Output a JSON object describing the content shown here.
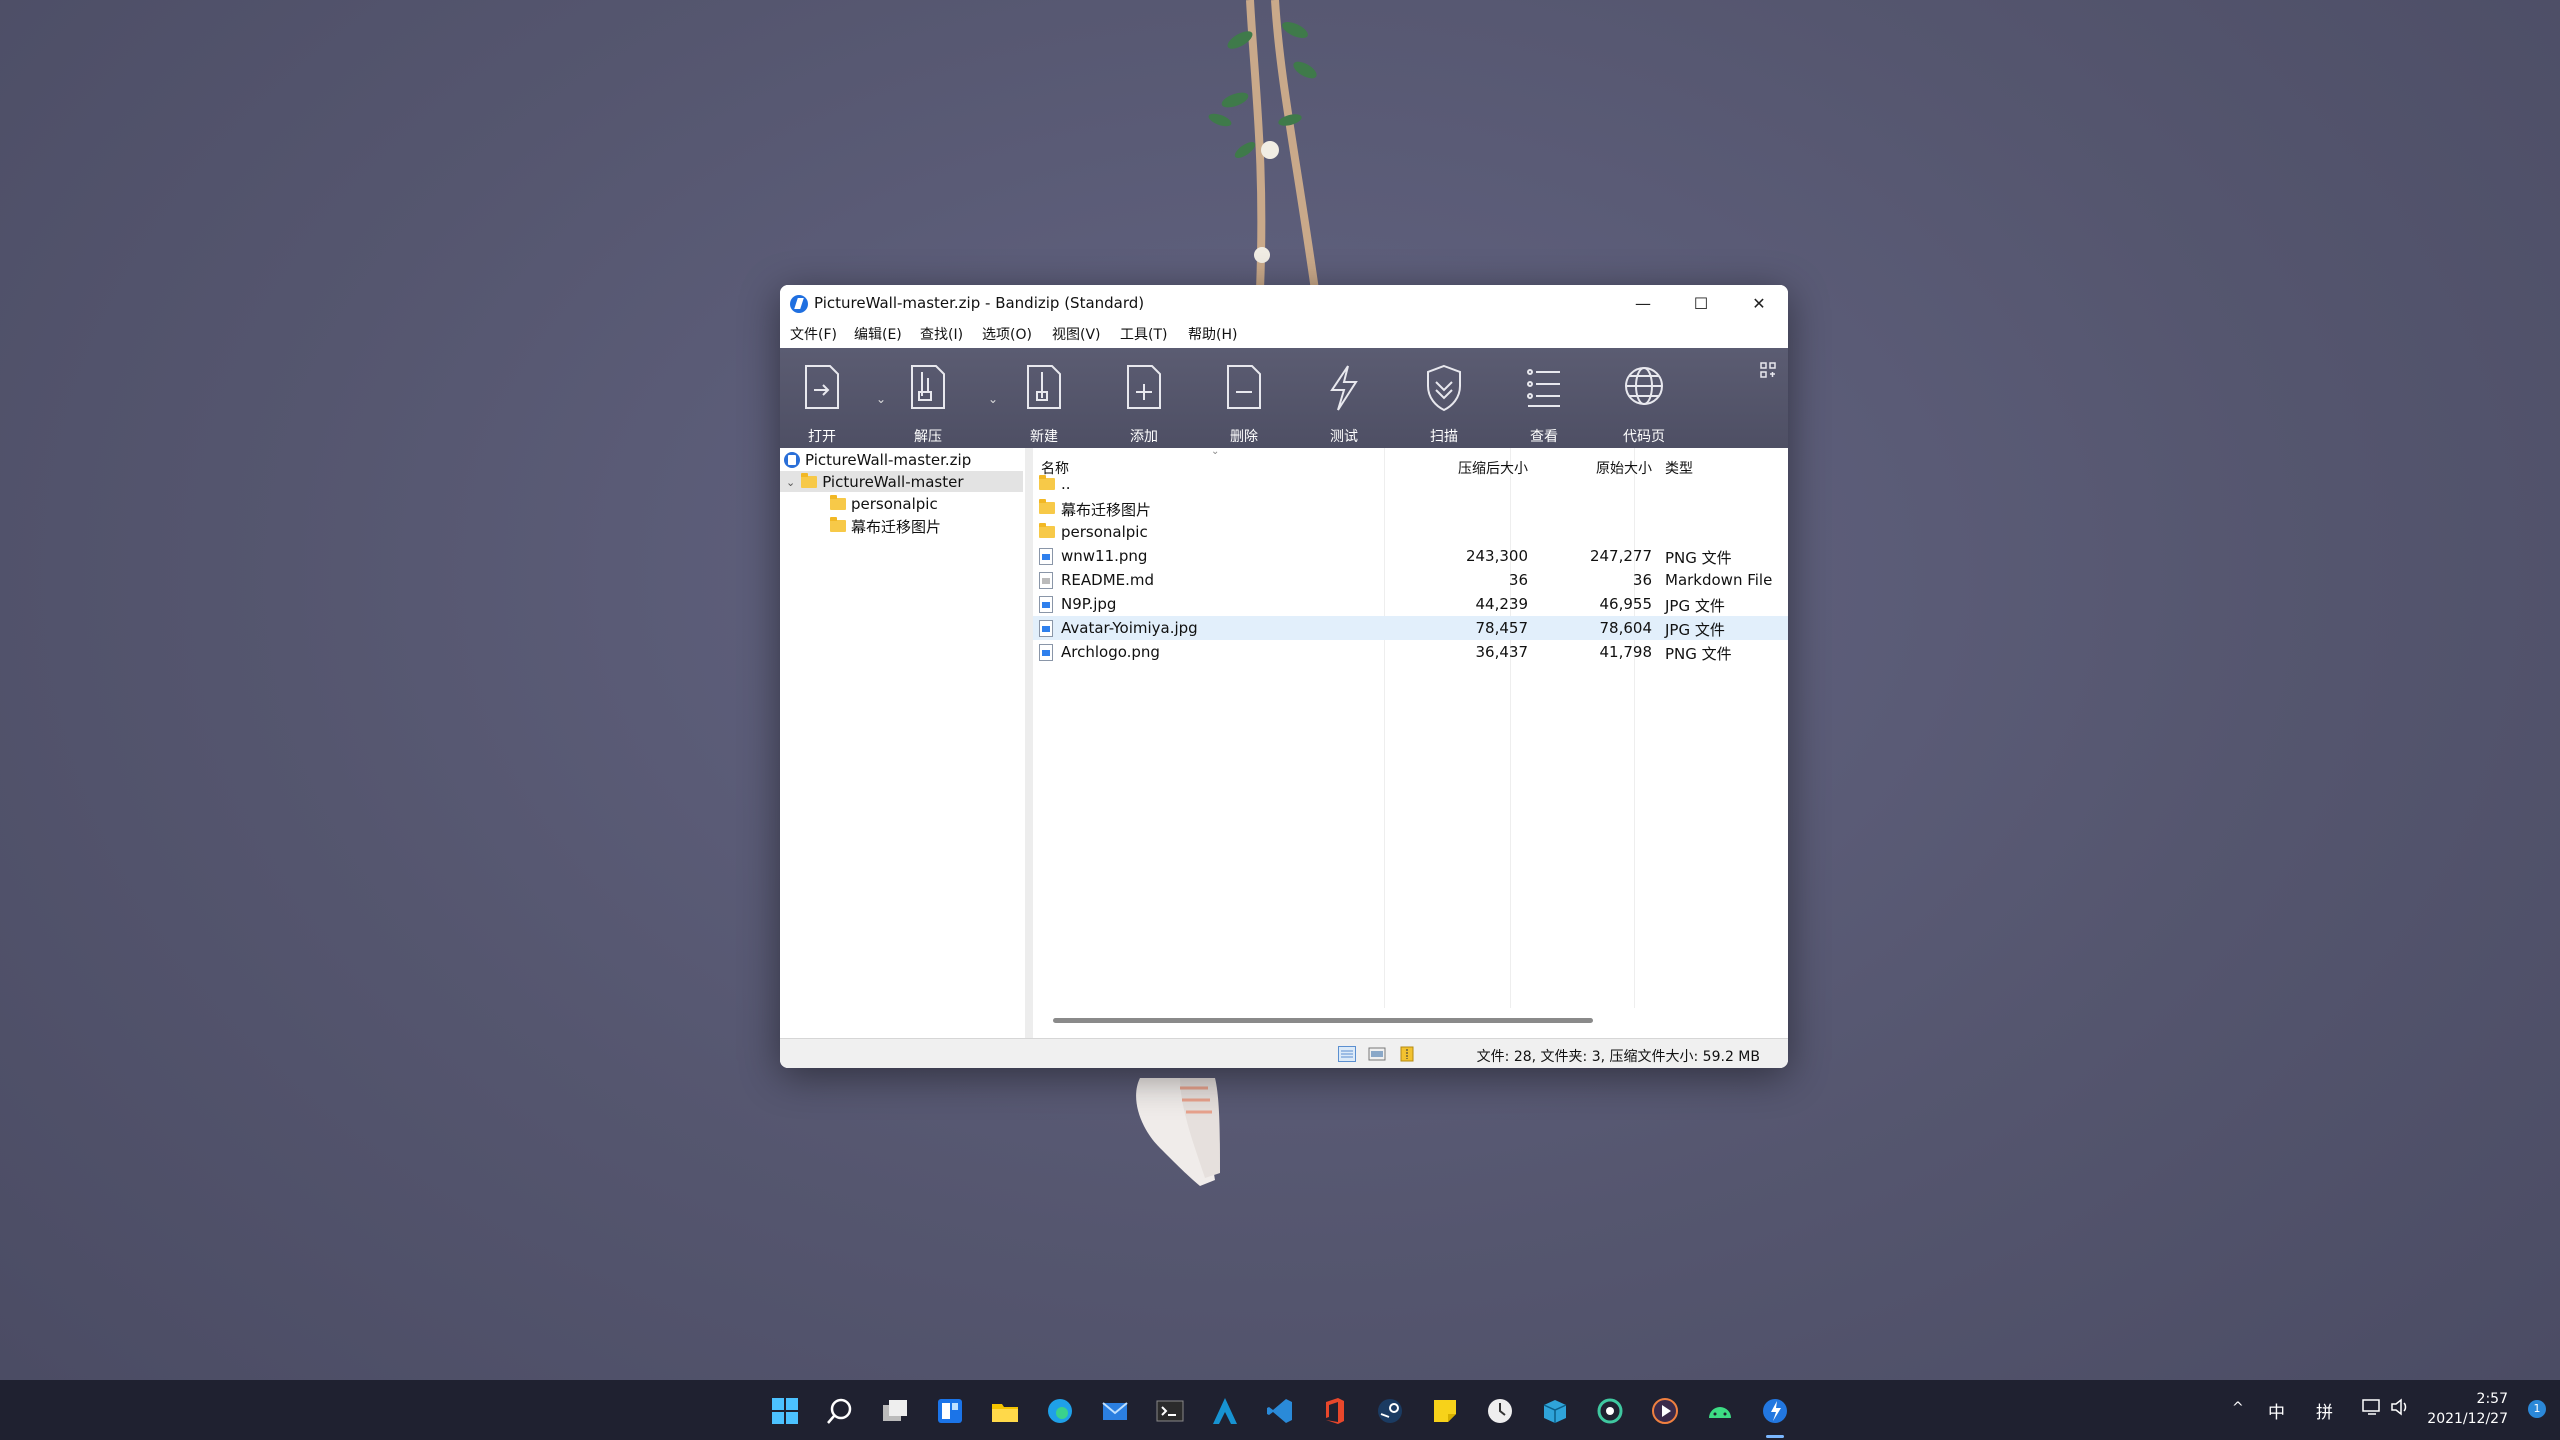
{
  "window": {
    "title": "PictureWall-master.zip - Bandizip (Standard)",
    "controls": {
      "minimize": "—",
      "maximize": "☐",
      "close": "✕"
    }
  },
  "menu": [
    "文件(F)",
    "编辑(E)",
    "查找(I)",
    "选项(O)",
    "视图(V)",
    "工具(T)",
    "帮助(H)"
  ],
  "toolbar": {
    "open": "打开",
    "extract": "解压",
    "new": "新建",
    "add": "添加",
    "delete": "删除",
    "test": "测试",
    "scan": "扫描",
    "view": "查看",
    "codepage": "代码页"
  },
  "tree": {
    "root": "PictureWall-master.zip",
    "folder": "PictureWall-master",
    "children": [
      "personalpic",
      "幕布迁移图片"
    ]
  },
  "columns": {
    "name": "名称",
    "compressed": "压缩后大小",
    "original": "原始大小",
    "type": "类型"
  },
  "files": [
    {
      "name": "..",
      "icon": "folder-icon",
      "compressed": "",
      "original": "",
      "type": ""
    },
    {
      "name": "幕布迁移图片",
      "icon": "folder-icon",
      "compressed": "",
      "original": "",
      "type": ""
    },
    {
      "name": "personalpic",
      "icon": "folder-icon",
      "compressed": "",
      "original": "",
      "type": ""
    },
    {
      "name": "wnw11.png",
      "icon": "image-file-icon",
      "compressed": "243,300",
      "original": "247,277",
      "type": "PNG 文件"
    },
    {
      "name": "README.md",
      "icon": "text-file-icon",
      "compressed": "36",
      "original": "36",
      "type": "Markdown File"
    },
    {
      "name": "N9P.jpg",
      "icon": "image-file-icon",
      "compressed": "44,239",
      "original": "46,955",
      "type": "JPG 文件"
    },
    {
      "name": "Avatar-Yoimiya.jpg",
      "icon": "image-file-icon",
      "compressed": "78,457",
      "original": "78,604",
      "type": "JPG 文件"
    },
    {
      "name": "Archlogo.png",
      "icon": "image-file-icon",
      "compressed": "36,437",
      "original": "41,798",
      "type": "PNG 文件"
    }
  ],
  "selected_row": "Avatar-Yoimiya.jpg",
  "status": "文件: 28, 文件夹: 3, 压缩文件大小: 59.2 MB",
  "taskbar": {
    "tray": {
      "chevron": "^",
      "ime_lang": "中",
      "ime_mode": "拼"
    },
    "time": "2:57",
    "date": "2021/12/27",
    "notifications": "1"
  },
  "colors": {
    "toolbar": "#55566b",
    "selection": "#e2effb",
    "accent": "#1f6fe0"
  }
}
